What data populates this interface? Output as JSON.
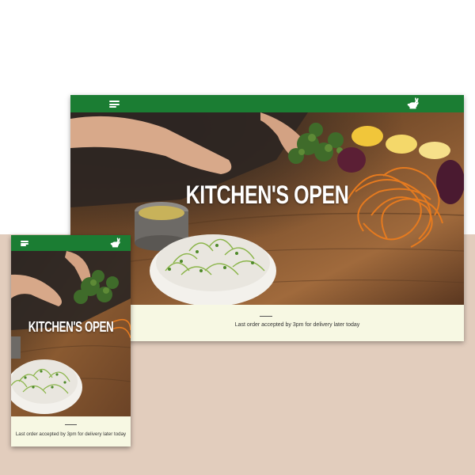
{
  "desktop": {
    "hero_title": "KITCHEN'S OPEN",
    "footer_text": "Last order accepted by 3pm for delivery later today"
  },
  "mobile": {
    "hero_title": "KITCHEN'S OPEN",
    "footer_text": "Last order accepted by 3pm for delivery later today"
  },
  "icons": {
    "menu": "hamburger-menu-icon",
    "logo": "rabbit-logo-icon"
  },
  "colors": {
    "nav_green": "#1b7d33",
    "footer_cream": "#f7f8e3",
    "backdrop_beige": "#e2cdbd"
  }
}
